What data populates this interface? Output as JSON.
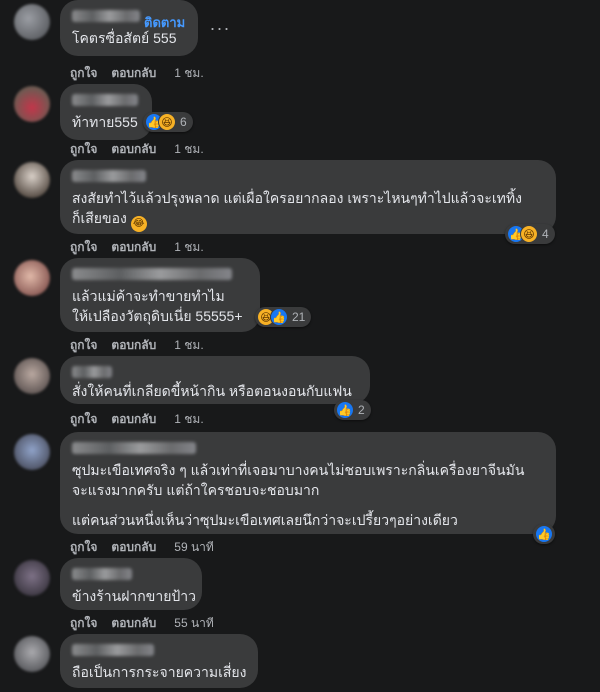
{
  "actions": {
    "like": "ถูกใจ",
    "reply": "ตอบกลับ"
  },
  "follow_label": "ติดตาม",
  "more_label": "...",
  "reaction_icons": {
    "like": "like-icon",
    "haha": "haha-icon"
  },
  "colors": {
    "background": "#18191a",
    "bubble": "#3a3b3c",
    "link": "#4599ff",
    "meta": "#b0b3b8"
  },
  "comments": [
    {
      "text": [
        "โคตรซื่อสัตย์ 555"
      ],
      "time": "1 ชม."
    },
    {
      "text": [
        "ท้าทาย555"
      ],
      "time": "1 ชม.",
      "reactions": "6"
    },
    {
      "text": [
        "สงสัยทำไว้แล้วปรุงพลาด แต่เผื่อใครอยากลอง เพราะไหนๆทำไปแล้วจะเททิ้ง",
        "ก็เสียของ"
      ],
      "time": "1 ชม.",
      "reactions": "4"
    },
    {
      "text": [
        "แล้วแม่ค้าจะทำขายทำไม",
        "ให้เปลืองวัตถุดิบเนี่ย 55555+"
      ],
      "time": "1 ชม.",
      "reactions": "21"
    },
    {
      "text": [
        "สั่งให้คนที่เกลียดขี้หน้ากิน หรือตอนงอนกับแฟน"
      ],
      "time": "1 ชม.",
      "reactions": "2"
    },
    {
      "text": [
        "ซุปมะเขือเทศจริง ๆ แล้วเท่าที่เจอมาบางคนไม่ชอบเพราะกลิ่นเครื่องยาจีนมัน",
        "จะแรงมากครับ แต่ถ้าใครชอบจะชอบมาก",
        "แต่คนส่วนหนึ่งเห็นว่าซุปมะเขือเทศเลยนึกว่าจะเปรี้ยวๆอย่างเดียว"
      ],
      "time": "59 นาที"
    },
    {
      "text": [
        "ข้างร้านฝากขายป้าว"
      ],
      "time": "55 นาที"
    },
    {
      "text": [
        "ถือเป็นการกระจายความเสี่ยง"
      ]
    }
  ]
}
